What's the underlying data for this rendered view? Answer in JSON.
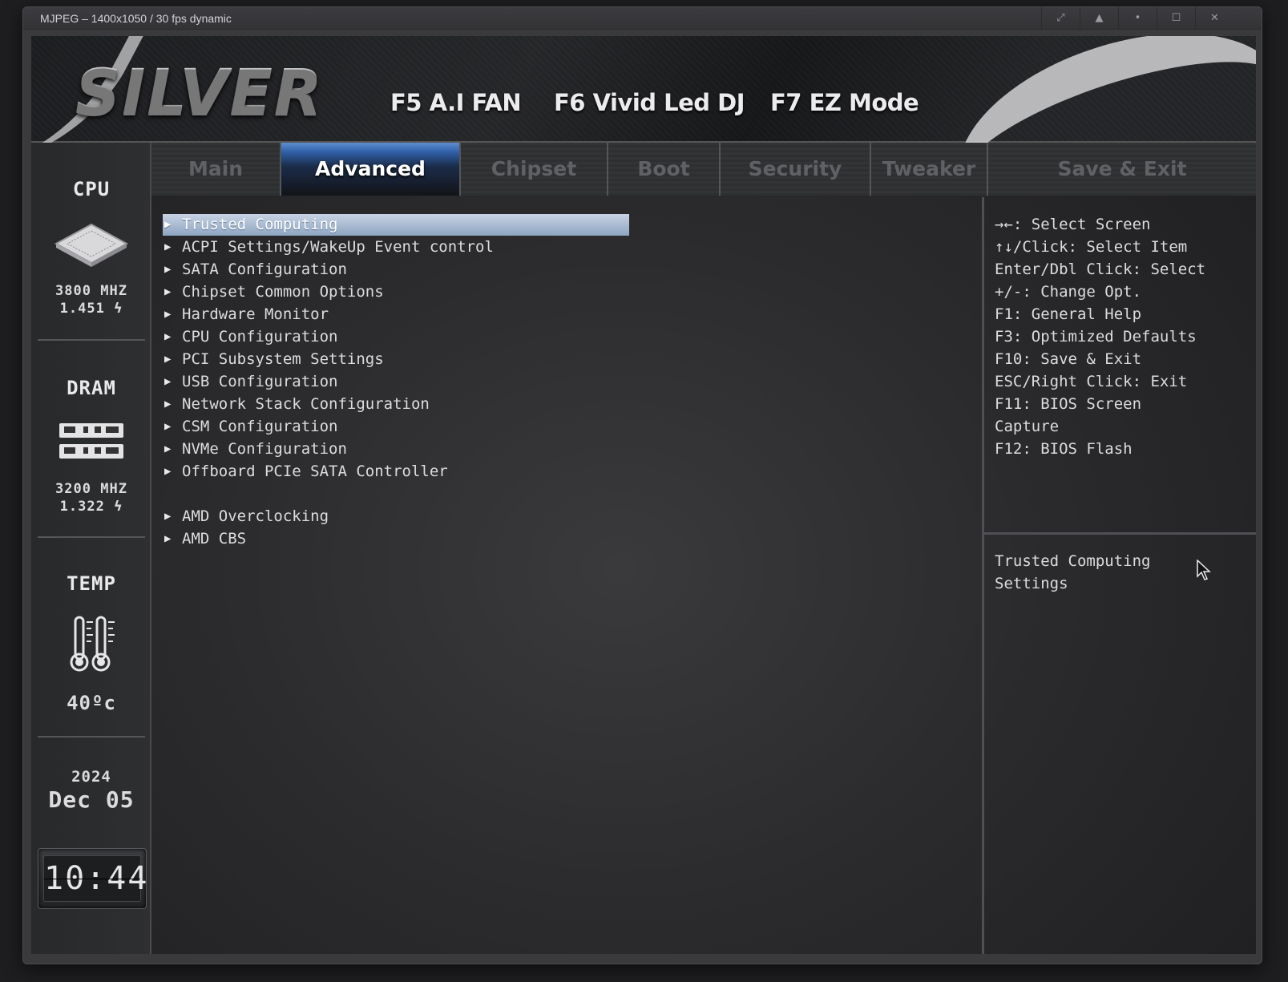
{
  "viewer": {
    "title": "MJPEG – 1400x1050 / 30 fps dynamic",
    "controls": [
      "expand-icon",
      "eject-icon",
      "dot-icon",
      "maximize-icon",
      "close-icon"
    ]
  },
  "banner": {
    "logo": "SILVER",
    "hotkeys": [
      "F5 A.I FAN",
      "F6 Vivid Led DJ",
      "F7 EZ Mode"
    ]
  },
  "sidebar": {
    "cpu": {
      "label": "CPU",
      "freq": "3800 MHZ",
      "volt": "1.451 ϟ"
    },
    "dram": {
      "label": "DRAM",
      "freq": "3200 MHZ",
      "volt": "1.322 ϟ"
    },
    "temp": {
      "label": "TEMP",
      "value": "40ºc"
    },
    "date": {
      "year": "2024",
      "day": "Dec 05"
    },
    "clock": "10:44"
  },
  "tabs": [
    {
      "label": "Main",
      "active": false
    },
    {
      "label": "Advanced",
      "active": true
    },
    {
      "label": "Chipset",
      "active": false
    },
    {
      "label": "Boot",
      "active": false
    },
    {
      "label": "Security",
      "active": false
    },
    {
      "label": "Tweaker",
      "active": false
    },
    {
      "label": "Save & Exit",
      "active": false
    }
  ],
  "menu": {
    "items": [
      {
        "label": "Trusted Computing",
        "selected": true
      },
      {
        "label": "ACPI Settings/WakeUp Event control"
      },
      {
        "label": "SATA Configuration"
      },
      {
        "label": "Chipset Common Options"
      },
      {
        "label": "Hardware Monitor"
      },
      {
        "label": "CPU Configuration"
      },
      {
        "label": "PCI Subsystem Settings"
      },
      {
        "label": "USB Configuration"
      },
      {
        "label": "Network Stack Configuration"
      },
      {
        "label": "CSM Configuration"
      },
      {
        "label": "NVMe Configuration"
      },
      {
        "label": "Offboard PCIe SATA Controller"
      },
      {
        "label": "AMD Overclocking"
      },
      {
        "label": "AMD CBS"
      }
    ]
  },
  "help": {
    "lines": [
      "→←: Select Screen",
      "↑↓/Click: Select Item",
      "Enter/Dbl Click: Select",
      "+/-: Change Opt.",
      "F1: General Help",
      "F3: Optimized Defaults",
      "F10: Save & Exit",
      "ESC/Right Click: Exit",
      "F11: BIOS Screen",
      "Capture",
      "F12: BIOS Flash"
    ],
    "description": [
      "Trusted Computing",
      "Settings"
    ]
  },
  "colors": {
    "active_tab": "#2f5fa6",
    "selection": "#8ea5c2",
    "text": "#dcdcde"
  }
}
